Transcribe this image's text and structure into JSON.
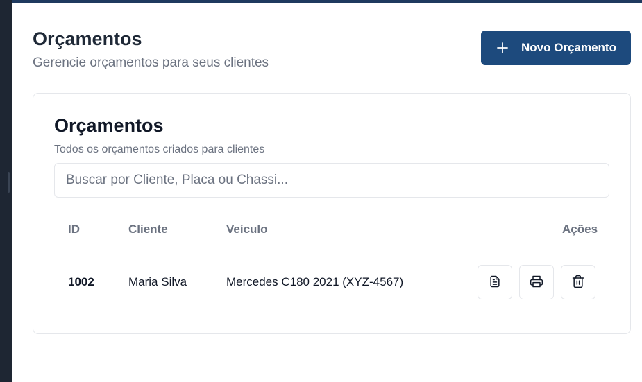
{
  "header": {
    "title": "Orçamentos",
    "subtitle": "Gerencie orçamentos para seus clientes",
    "new_button_label": "Novo Orçamento"
  },
  "card": {
    "title": "Orçamentos",
    "subtitle": "Todos os orçamentos criados para clientes",
    "search": {
      "placeholder": "Buscar por Cliente, Placa ou Chassi...",
      "value": ""
    }
  },
  "table": {
    "columns": {
      "id": "ID",
      "cliente": "Cliente",
      "veiculo": "Veículo",
      "acoes": "Ações"
    },
    "rows": [
      {
        "id": "1002",
        "cliente": "Maria Silva",
        "veiculo": "Mercedes C180 2021 (XYZ-4567)"
      }
    ],
    "row_actions": [
      "document-icon",
      "printer-icon",
      "trash-icon"
    ]
  },
  "colors": {
    "primary": "#1d4a7d",
    "top_bar": "#1f3a5f",
    "sidebar": "#1e2633",
    "muted_text": "#6b7280"
  }
}
